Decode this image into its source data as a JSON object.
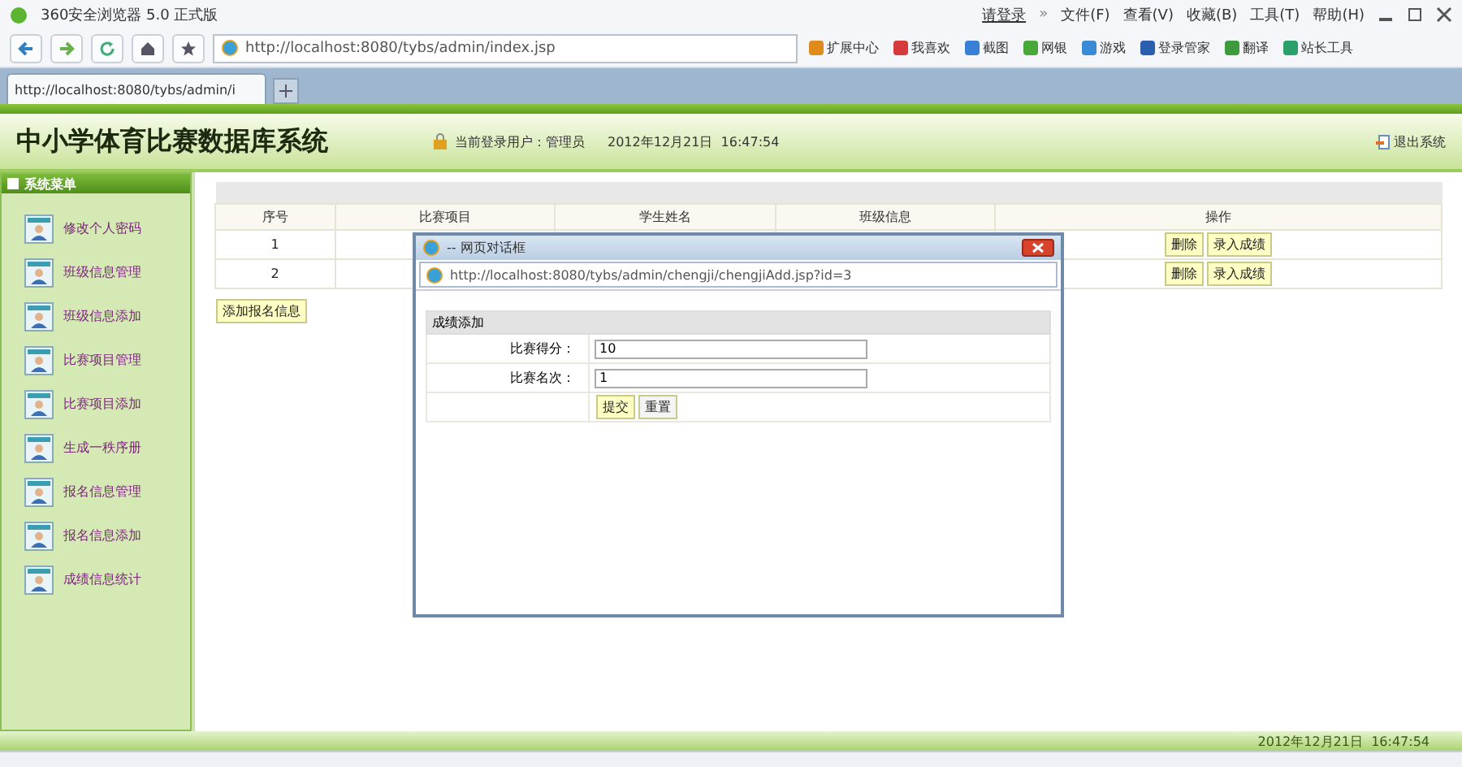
{
  "browser": {
    "title": "360安全浏览器 5.0 正式版",
    "login": "请登录",
    "more": "»",
    "menu": [
      "文件(F)",
      "查看(V)",
      "收藏(B)",
      "工具(T)",
      "帮助(H)"
    ],
    "address": "http://localhost:8080/tybs/admin/index.jsp",
    "extensions": [
      "扩展中心",
      "我喜欢",
      "截图",
      "网银",
      "游戏",
      "登录管家",
      "翻译",
      "站长工具"
    ],
    "tabs": [
      {
        "label": "http://localhost:8080/tybs/admin/i",
        "selected": true
      }
    ]
  },
  "header": {
    "title": "中小学体育比赛数据库系统",
    "user": "当前登录用户：管理员",
    "datetime": "2012年12月21日  16:47:54",
    "logout": "退出系统"
  },
  "sidebar": {
    "title": "系统菜单",
    "items": [
      "修改个人密码",
      "班级信息管理",
      "班级信息添加",
      "比赛项目管理",
      "比赛项目添加",
      "生成一秩序册",
      "报名信息管理",
      "报名信息添加",
      "成绩信息统计"
    ]
  },
  "table": {
    "columns": [
      "序号",
      "比赛项目",
      "学生姓名",
      "班级信息",
      "操作"
    ],
    "rows": [
      {
        "index": "1",
        "actions": [
          "删除",
          "录入成绩"
        ]
      },
      {
        "index": "2",
        "actions": [
          "删除",
          "录入成绩"
        ]
      }
    ]
  },
  "add_button": "添加报名信息",
  "dialog": {
    "title": "-- 网页对话框",
    "url": "http://localhost:8080/tybs/admin/chengji/chengjiAdd.jsp?id=3",
    "form_title": "成绩添加",
    "fields": [
      {
        "label": "比赛得分：",
        "value": "10"
      },
      {
        "label": "比赛名次：",
        "value": "1"
      }
    ],
    "buttons": [
      "提交",
      "重置"
    ]
  },
  "footer": {
    "datetime": "2012年12月21日  16:47:54"
  }
}
